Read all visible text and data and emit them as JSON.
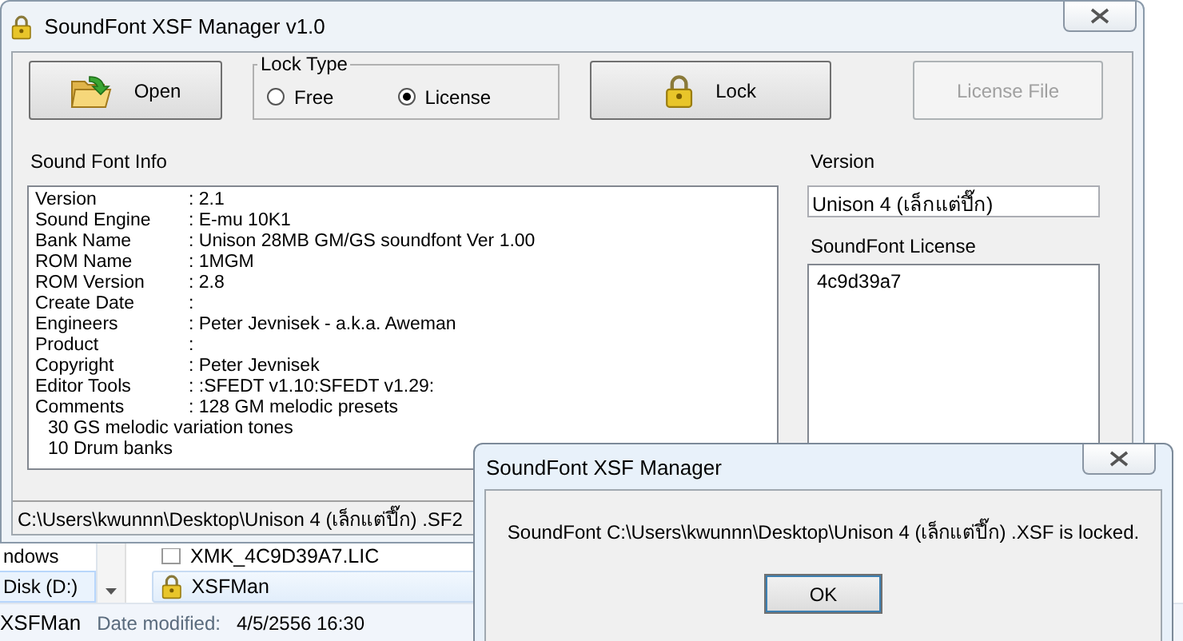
{
  "main_window": {
    "title": "SoundFont XSF Manager v1.0",
    "toolbar": [
      {
        "kind": "button",
        "label": "Open",
        "disabled": false
      },
      {
        "kind": "radio_group",
        "label": "Lock Type",
        "options": [
          {
            "label": "Free",
            "selected": false
          },
          {
            "label": "License",
            "selected": true
          }
        ]
      },
      {
        "kind": "button",
        "label": "Lock",
        "disabled": false
      },
      {
        "kind": "button",
        "label": "License File",
        "disabled": true
      }
    ],
    "info": {
      "label": "Sound Font Info",
      "rows": [
        {
          "field": "Version",
          "value": ": 2.1"
        },
        {
          "field": "Sound Engine",
          "value": ": E-mu 10K1"
        },
        {
          "field": "Bank Name",
          "value": ": Unison 28MB GM/GS soundfont Ver 1.00"
        },
        {
          "field": "ROM Name",
          "value": ": 1MGM"
        },
        {
          "field": "ROM Version",
          "value": ": 2.8"
        },
        {
          "field": "Create Date",
          "value": ":"
        },
        {
          "field": "Engineers",
          "value": ": Peter Jevnisek - a.k.a. Aweman"
        },
        {
          "field": "Product",
          "value": ":"
        },
        {
          "field": "Copyright",
          "value": ": Peter Jevnisek"
        },
        {
          "field": "Editor Tools",
          "value": ": :SFEDT v1.10:SFEDT v1.29:"
        },
        {
          "field": "Comments",
          "value": ": 128 GM melodic presets"
        }
      ],
      "extra_lines": [
        "30 GS melodic variation tones",
        "10 Drum banks"
      ]
    },
    "version": {
      "label": "Version",
      "value": "Unison 4  (เล็กแต่ปึ๊ก)"
    },
    "license": {
      "label": "SoundFont License",
      "value": "4c9d39a7"
    },
    "status_bar": "C:\\Users\\kwunnn\\Desktop\\Unison 4  (เล็กแต่ปึ๊ก) .SF2"
  },
  "explorer": {
    "nav_items": [
      {
        "label": "ndows",
        "selected": false
      },
      {
        "label": "Disk (D:)",
        "selected": true
      }
    ],
    "files": [
      {
        "name": "XMK_4C9D39A7.LIC",
        "kind": "file",
        "selected": false
      },
      {
        "name": "XSFMan",
        "kind": "lock",
        "selected": true
      }
    ],
    "details": {
      "name": "XSFMan",
      "label": "Date modified:",
      "value": "4/5/2556 16:30"
    }
  },
  "dialog": {
    "title": "SoundFont XSF Manager",
    "message": "SoundFont C:\\Users\\kwunnn\\Desktop\\Unison 4  (เล็กแต่ปึ๊ก) .XSF is locked.",
    "button": "OK"
  }
}
